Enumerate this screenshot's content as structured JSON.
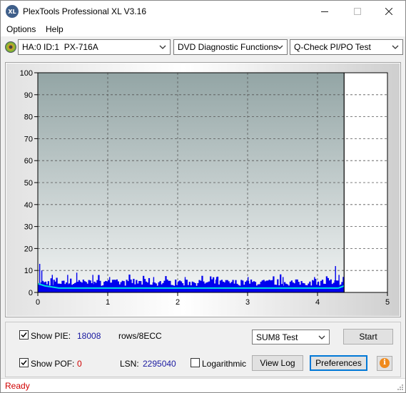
{
  "window": {
    "title": "PlexTools Professional XL V3.16",
    "icon_text": "XL",
    "icons": {
      "app": "plextools-logo-icon",
      "minimize": "minimize-icon",
      "maximize": "maximize-icon",
      "close": "close-icon"
    }
  },
  "menu": {
    "items": [
      "Options",
      "Help"
    ]
  },
  "toolbar": {
    "drive": "HA:0 ID:1  PX-716A",
    "function": "DVD Diagnostic Functions",
    "test": "Q-Check PI/PO Test",
    "icons": {
      "drive": "disc-icon",
      "dropdown": "chevron-down-icon"
    }
  },
  "chart_data": {
    "type": "bar",
    "x_ticks": [
      "0",
      "1",
      "2",
      "3",
      "4",
      "5"
    ],
    "y_ticks": [
      "0",
      "10",
      "20",
      "30",
      "40",
      "50",
      "60",
      "70",
      "80",
      "90",
      "100"
    ],
    "xlim": [
      0,
      5
    ],
    "ylim": [
      0,
      100
    ],
    "data_end_x": 4.38,
    "grid": true,
    "plot_background": "#93a5a5",
    "series": [
      {
        "kind": "bars",
        "color": "#0000ee",
        "typical_range": [
          3,
          6
        ],
        "spikes": [
          {
            "x": 0.02,
            "y": 13
          },
          {
            "x": 0.05,
            "y": 10
          },
          {
            "x": 0.2,
            "y": 8
          },
          {
            "x": 0.42,
            "y": 8
          },
          {
            "x": 0.55,
            "y": 9
          },
          {
            "x": 0.78,
            "y": 8
          },
          {
            "x": 1.02,
            "y": 7
          },
          {
            "x": 1.3,
            "y": 8
          },
          {
            "x": 1.65,
            "y": 7
          },
          {
            "x": 2.1,
            "y": 7
          },
          {
            "x": 2.55,
            "y": 7
          },
          {
            "x": 3.0,
            "y": 7
          },
          {
            "x": 3.5,
            "y": 7
          },
          {
            "x": 3.95,
            "y": 7
          },
          {
            "x": 4.25,
            "y": 12
          },
          {
            "x": 4.3,
            "y": 8
          }
        ]
      },
      {
        "kind": "line",
        "color": "#00e0e0",
        "points": [
          {
            "x": 0,
            "y": 4
          },
          {
            "x": 0.1,
            "y": 3
          },
          {
            "x": 0.3,
            "y": 2
          },
          {
            "x": 1.0,
            "y": 2
          },
          {
            "x": 2.0,
            "y": 2
          },
          {
            "x": 3.0,
            "y": 2
          },
          {
            "x": 4.0,
            "y": 2
          },
          {
            "x": 4.3,
            "y": 2
          },
          {
            "x": 4.38,
            "y": 3
          }
        ]
      }
    ]
  },
  "controls": {
    "show_pie_label": "Show PIE:",
    "show_pie_checked": true,
    "pie_value": "18008",
    "pie_unit": "rows/8ECC",
    "show_pof_label": "Show POF:",
    "show_pof_checked": true,
    "pof_value": "0",
    "lsn_label": "LSN:",
    "lsn_value": "2295040",
    "logarithmic_label": "Logarithmic",
    "logarithmic_checked": false,
    "sum_select": "SUM8 Test",
    "start_button": "Start",
    "view_log_button": "View Log",
    "preferences_button": "Preferences",
    "info_icon": "info-icon",
    "info_glyph": "i",
    "check_icon": "check-icon"
  },
  "status": {
    "text": "Ready"
  },
  "colors": {
    "status_text": "#d00000",
    "pie_value": "#1a1aa0",
    "pof_value": "#d00000",
    "focus_border": "#0078d7"
  }
}
